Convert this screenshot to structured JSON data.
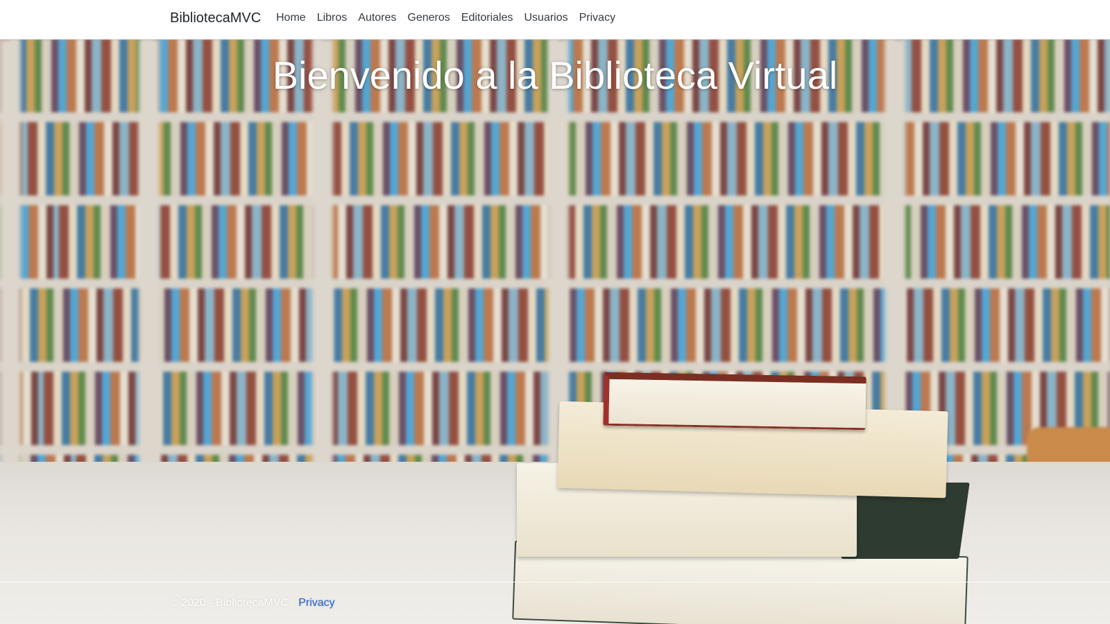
{
  "navbar": {
    "brand": "BibliotecaMVC",
    "items": [
      {
        "label": "Home"
      },
      {
        "label": "Libros"
      },
      {
        "label": "Autores"
      },
      {
        "label": "Generos"
      },
      {
        "label": "Editoriales"
      },
      {
        "label": "Usuarios"
      },
      {
        "label": "Privacy"
      }
    ]
  },
  "hero": {
    "title": "Bienvenido a la Biblioteca Virtual"
  },
  "footer": {
    "text": "© 2020 - BibliotecaMVC - ",
    "link_label": "Privacy",
    "link_color": "#1f5fd1"
  }
}
